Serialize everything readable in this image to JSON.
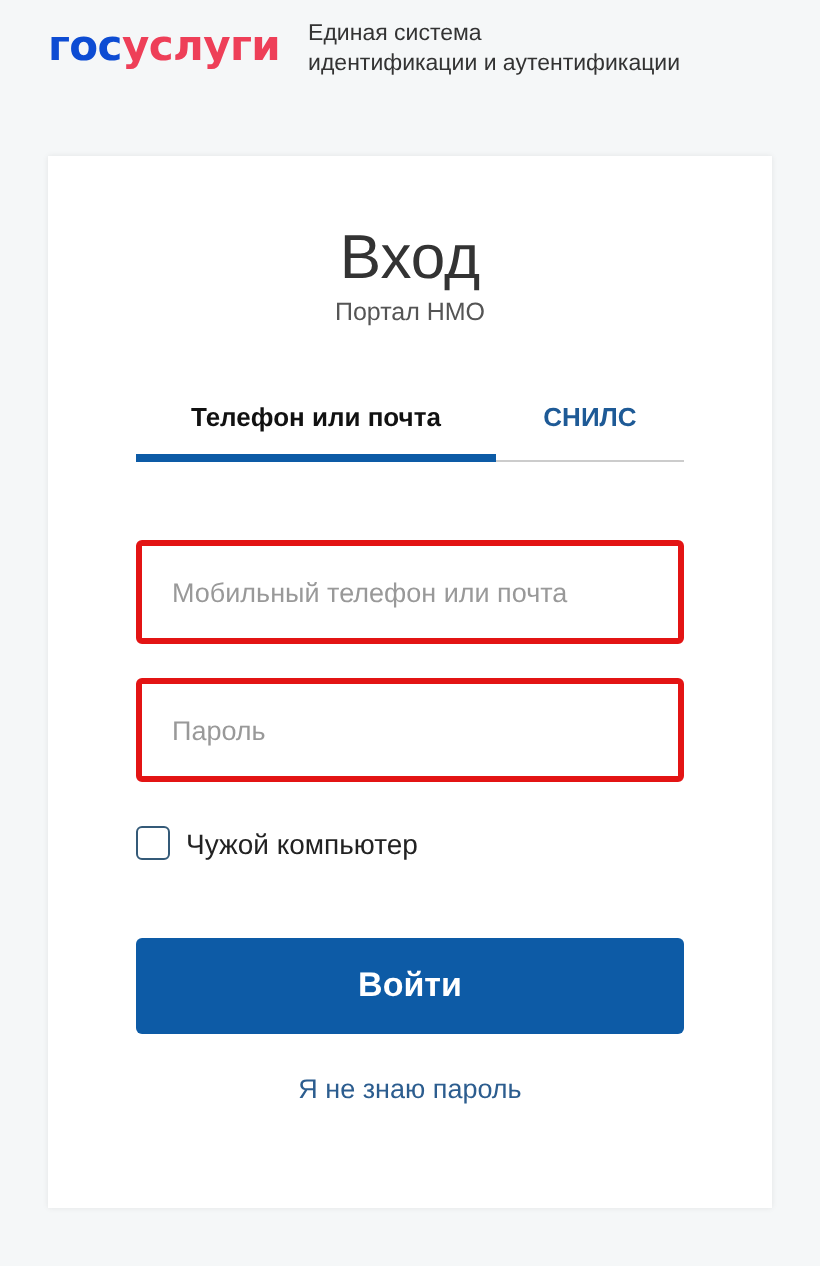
{
  "header": {
    "logo": [
      {
        "text": "гос",
        "color": "#0d4cd3"
      },
      {
        "text": "услуги",
        "color": "#ee3f58"
      }
    ],
    "tagline": [
      "Единая система",
      "идентификации и аутентификации"
    ]
  },
  "login": {
    "title": "Вход",
    "subtitle": "Портал НМО",
    "tabs": [
      {
        "label": "Телефон или почта",
        "selected": true
      },
      {
        "label": "СНИЛС",
        "selected": false
      }
    ],
    "fields": [
      {
        "placeholder": "Мобильный телефон или почта",
        "highlighted": true
      },
      {
        "placeholder": "Пароль",
        "highlighted": true
      }
    ],
    "checkbox": {
      "label": "Чужой компьютер",
      "checked": false
    },
    "submit": "Войти",
    "link": "Я не знаю пароль"
  }
}
